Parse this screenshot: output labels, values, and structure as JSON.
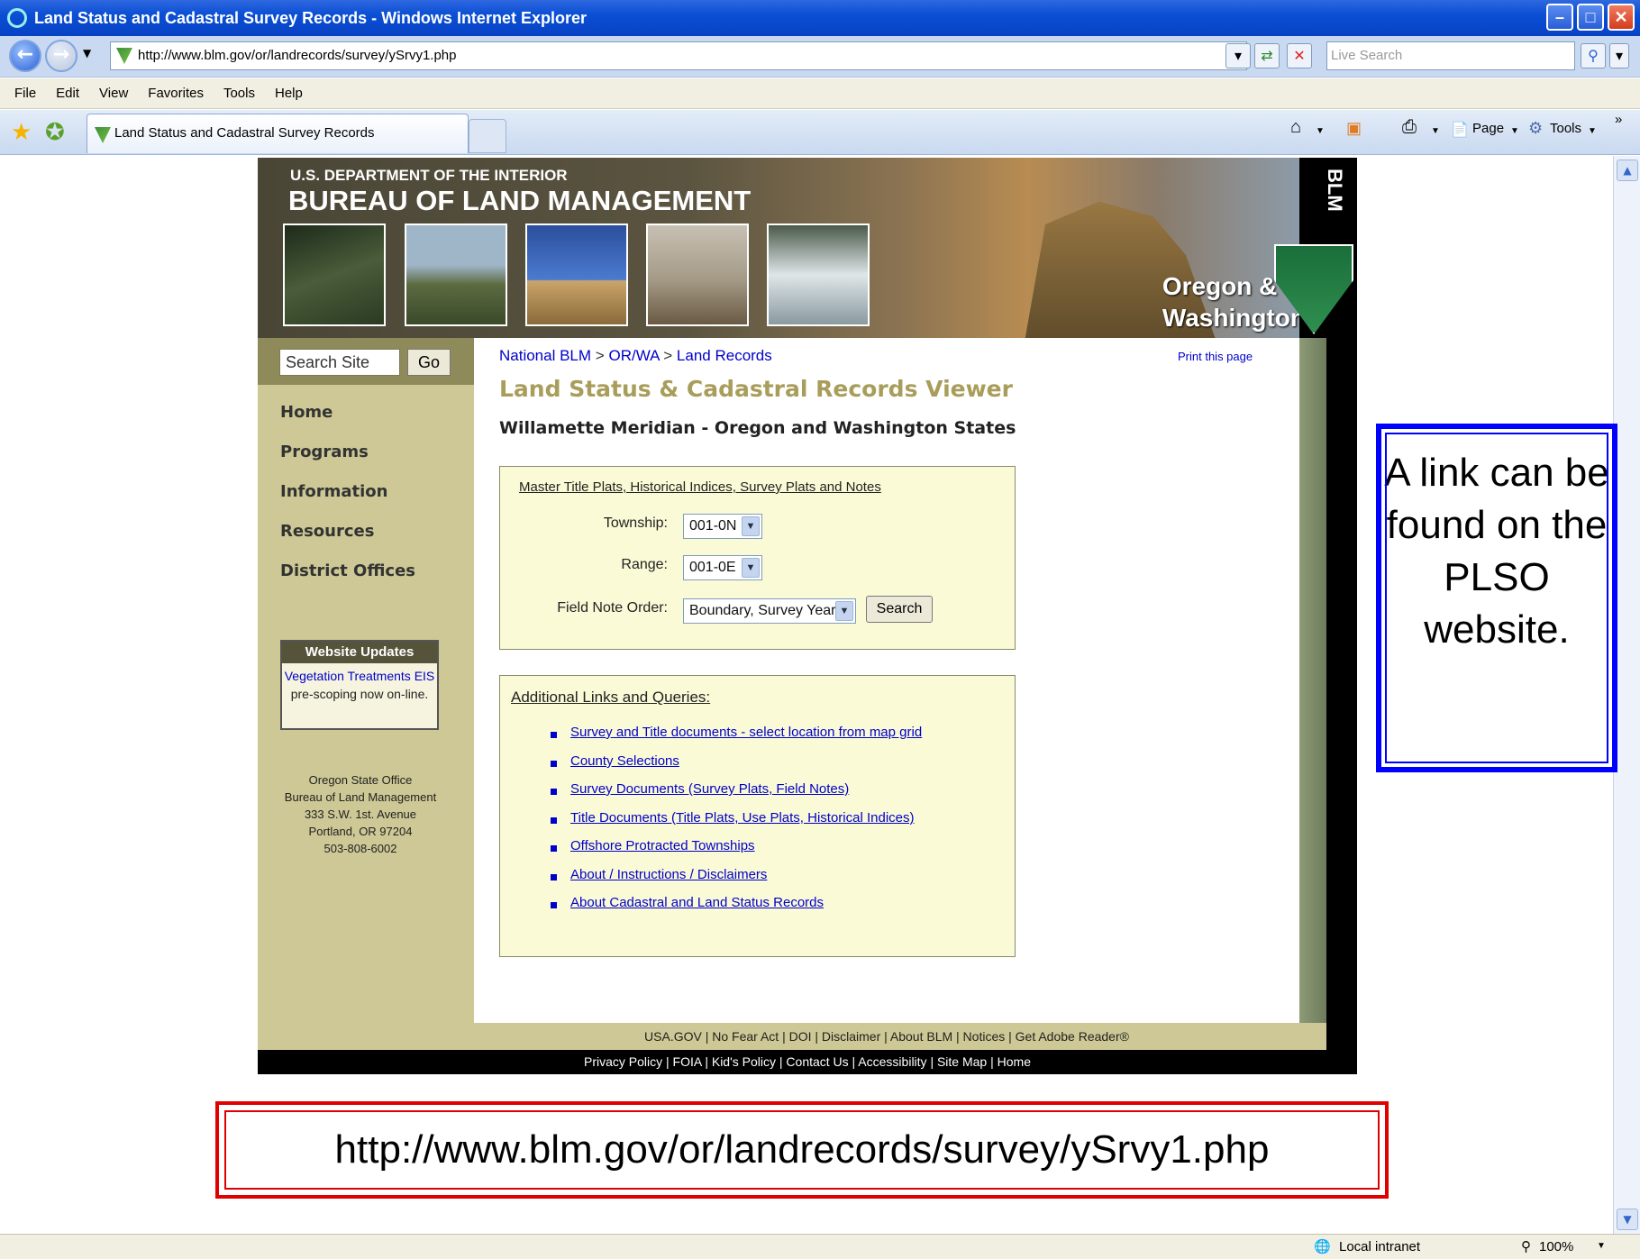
{
  "window": {
    "title": "Land Status and Cadastral Survey Records - Windows Internet Explorer",
    "url": "http://www.blm.gov/or/landrecords/survey/ySrvy1.php",
    "live_search_placeholder": "Live Search"
  },
  "menu": [
    "File",
    "Edit",
    "View",
    "Favorites",
    "Tools",
    "Help"
  ],
  "tab": {
    "label": "Land Status and Cadastral Survey Records"
  },
  "toolbar": {
    "page_label": "Page",
    "tools_label": "Tools"
  },
  "status": {
    "zone": "Local intranet",
    "zoom": "100%"
  },
  "banner": {
    "dept": "U.S. DEPARTMENT OF THE INTERIOR",
    "bureau": "BUREAU OF LAND MANAGEMENT",
    "region_line1": "Oregon &",
    "region_line2": "Washington",
    "side_label": "BLM"
  },
  "sidebar": {
    "search_placeholder": "Search Site",
    "go_label": "Go",
    "nav": [
      "Home",
      "Programs",
      "Information",
      "Resources",
      "District Offices"
    ],
    "updates_title": "Website Updates",
    "updates_link": "Vegetation Treatments EIS",
    "updates_text": "pre-scoping now on-line.",
    "address": [
      "Oregon State Office",
      "Bureau of Land Management",
      "333 S.W. 1st. Avenue",
      "Portland, OR 97204",
      "503-808-6002"
    ]
  },
  "breadcrumb": {
    "items": [
      "National BLM",
      "OR/WA",
      "Land Records"
    ],
    "separator": ">"
  },
  "print_link": "Print this page",
  "heading": "Land Status & Cadastral Records Viewer",
  "subheading": "Willamette Meridian - Oregon and Washington States",
  "form": {
    "title": "Master Title Plats,  Historical Indices,  Survey Plats and Notes",
    "township_label": "Township:",
    "township_value": "001-0N",
    "range_label": "Range:",
    "range_value": "001-0E",
    "order_label": "Field Note Order:",
    "order_value": "Boundary, Survey Year",
    "search_label": "Search"
  },
  "links": {
    "title": "Additional Links and Queries:",
    "items": [
      "Survey and Title documents - select location from map grid",
      "County Selections",
      "Survey Documents   (Survey Plats, Field Notes)",
      "Title Documents   (Title Plats, Use Plats, Historical Indices)",
      "Offshore Protracted Townships",
      "About / Instructions / Disclaimers",
      "About Cadastral and Land Status Records"
    ]
  },
  "footer": {
    "row1": "USA.GOV  |  No Fear Act  |  DOI  |  Disclaimer  |  About BLM  |  Notices  |  Get Adobe Reader®",
    "row2": "Privacy Policy  |  FOIA  |  Kid's Policy  |  Contact Us  |  Accessibility |  Site Map  |  Home"
  },
  "callout": {
    "text": "A link can be found on the PLSO website."
  },
  "url_caption": "http://www.blm.gov/or/landrecords/survey/ySrvy1.php"
}
